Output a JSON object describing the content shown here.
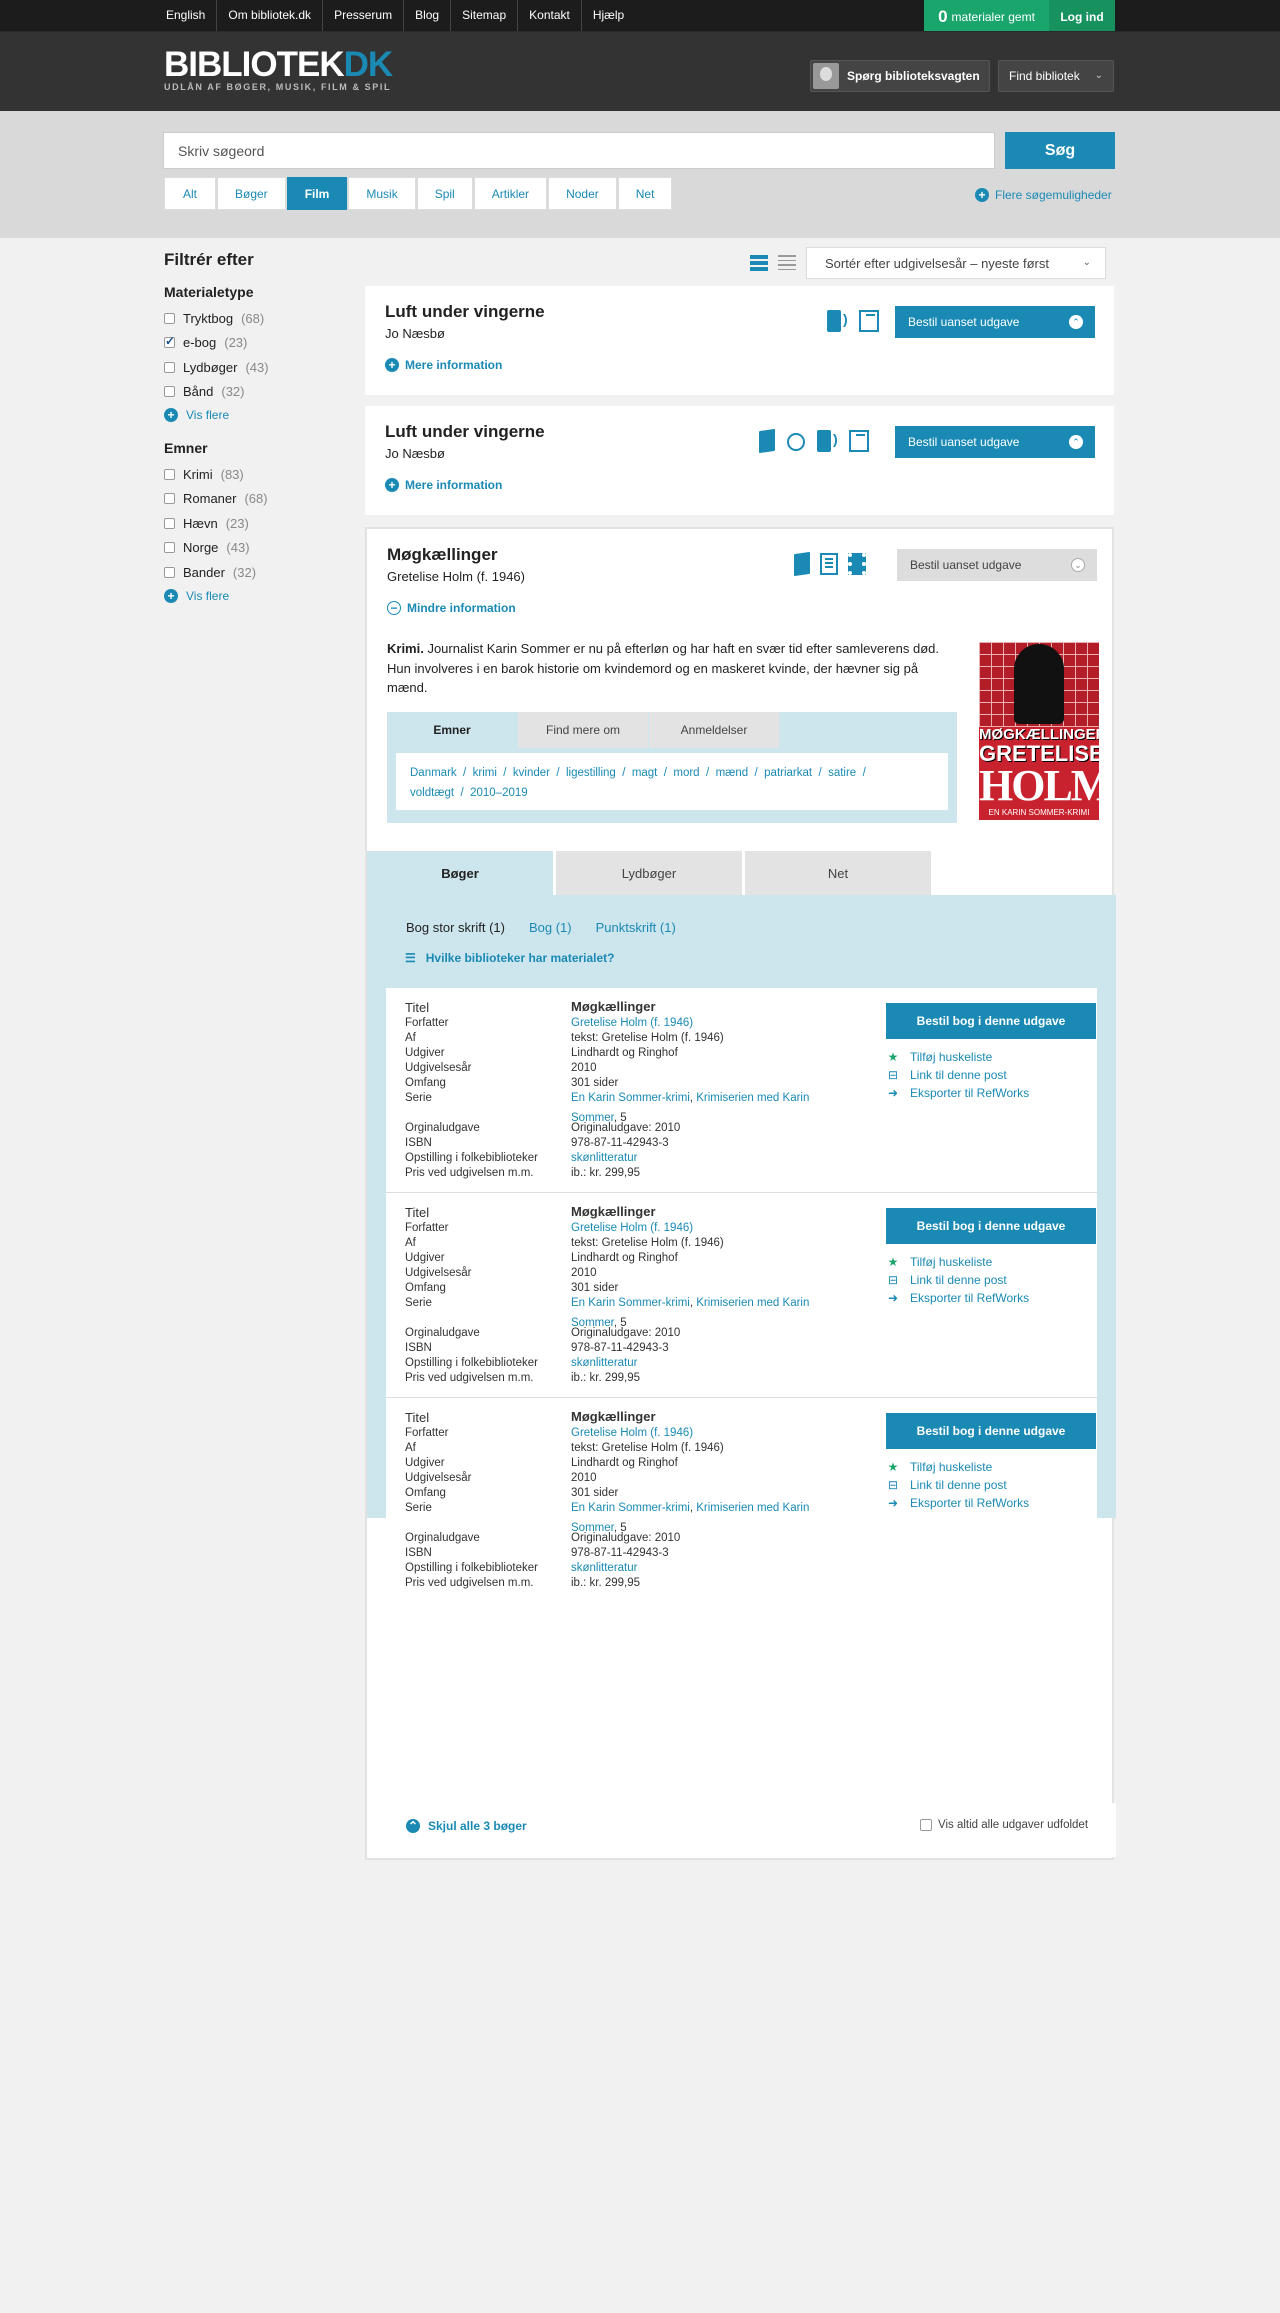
{
  "topnav": {
    "links": [
      "English",
      "Om bibliotek.dk",
      "Presserum",
      "Blog",
      "Sitemap",
      "Kontakt",
      "Hjælp"
    ],
    "saved_count": "0",
    "saved_label": "materialer gemt",
    "login": "Log ind"
  },
  "header": {
    "logo_main": "BIBLIOTEK",
    "logo_accent": "DK",
    "logo_sub": "UDLÅN AF BØGER, MUSIK, FILM & SPIL",
    "ask_label": "Spørg biblioteksvagten",
    "find_library": "Find bibliotek"
  },
  "search": {
    "placeholder": "Skriv søgeord",
    "button": "Søg",
    "tabs": [
      "Alt",
      "Bøger",
      "Film",
      "Musik",
      "Spil",
      "Artikler",
      "Noder",
      "Net"
    ],
    "active_tab": "Film",
    "more_options": "Flere søgemuligheder"
  },
  "sidebar": {
    "title": "Filtrér efter",
    "groups": [
      {
        "title": "Materialetype",
        "items": [
          {
            "label": "Tryktbog",
            "count": "(68)",
            "checked": false
          },
          {
            "label": "e-bog",
            "count": "(23)",
            "checked": true
          },
          {
            "label": "Lydbøger",
            "count": "(43)",
            "checked": false
          },
          {
            "label": "Bånd",
            "count": "(32)",
            "checked": false
          }
        ],
        "more": "Vis flere"
      },
      {
        "title": "Emner",
        "items": [
          {
            "label": "Krimi",
            "count": "(83)",
            "checked": false
          },
          {
            "label": "Romaner",
            "count": "(68)",
            "checked": false
          },
          {
            "label": "Hævn",
            "count": "(23)",
            "checked": false
          },
          {
            "label": "Norge",
            "count": "(43)",
            "checked": false
          },
          {
            "label": "Bander",
            "count": "(32)",
            "checked": false
          }
        ],
        "more": "Vis flere"
      }
    ]
  },
  "sort": {
    "label": "Sortér efter udgivelsesår – nyeste først"
  },
  "results": [
    {
      "title": "Luft under vingerne",
      "author": "Jo Næsbø",
      "order": "Bestil uanset udgave",
      "more": "Mere information"
    },
    {
      "title": "Luft under vingerne",
      "author": "Jo Næsbø",
      "order": "Bestil uanset udgave",
      "more": "Mere information"
    },
    {
      "title": "Møgkællinger",
      "author": "Gretelise Holm (f. 1946)",
      "order": "Bestil uanset udgave",
      "less": "Mindre information",
      "desc_bold": "Krimi.",
      "desc": " Journalist Karin Sommer er nu på efterløn og har haft en svær tid efter  samleverens død. Hun involveres i en barok historie om kvindemord og en maskeret kvinde, der hævner sig på mænd.",
      "cover": {
        "title": "MØGKÆLLINGER",
        "author_first": "GRETELISE",
        "author_last": "HOLM",
        "tagline": "EN KARIN SOMMER-KRIMI"
      },
      "subject_tabs": [
        "Emner",
        "Find mere om",
        "Anmeldelser"
      ],
      "subjects": [
        "Danmark",
        "krimi",
        "kvinder",
        "ligestilling",
        "magt",
        "mord",
        "mænd",
        "patriarkat",
        "satire",
        "voldtægt",
        "2010–2019"
      ],
      "material_tabs": [
        "Bøger",
        "Lydbøger",
        "Net"
      ],
      "edition_links": [
        "Bog stor skrift (1)",
        "Bog (1)",
        "Punktskrift (1)"
      ],
      "which_libraries": "Hvilke biblioteker har materialet?",
      "edition": {
        "labels": [
          "Titel",
          "Forfatter",
          "Af",
          "Udgiver",
          "Udgivelsesår",
          "Omfang",
          "Serie",
          "Orginaludgave",
          "ISBN",
          "Opstilling i folkebiblioteker",
          "Pris ved udgivelsen m.m."
        ],
        "title": "Møgkællinger",
        "author": "Gretelise Holm (f. 1946)",
        "by": "tekst: Gretelise Holm (f. 1946)",
        "publisher": "Lindhardt og Ringhof",
        "year": "2010",
        "extent": "301 sider",
        "series_a": "En Karin Sommer-krimi",
        "series_sep": ", ",
        "series_b": "Krimiserien med Karin",
        "series_c": "Sommer",
        "series_num": ", 5",
        "original": "Originaludgave: 2010",
        "isbn": "978-87-11-42943-3",
        "shelf": "skønlitteratur",
        "price": "ib.: kr. 299,95",
        "order": "Bestil bog i denne udgave",
        "fav": "Tilføj huskeliste",
        "link": "Link til denne post",
        "export": "Eksporter til RefWorks"
      },
      "hide_all": "Skjul alle 3 bøger",
      "always_show": "Vis altid alle udgaver udfoldet"
    }
  ]
}
